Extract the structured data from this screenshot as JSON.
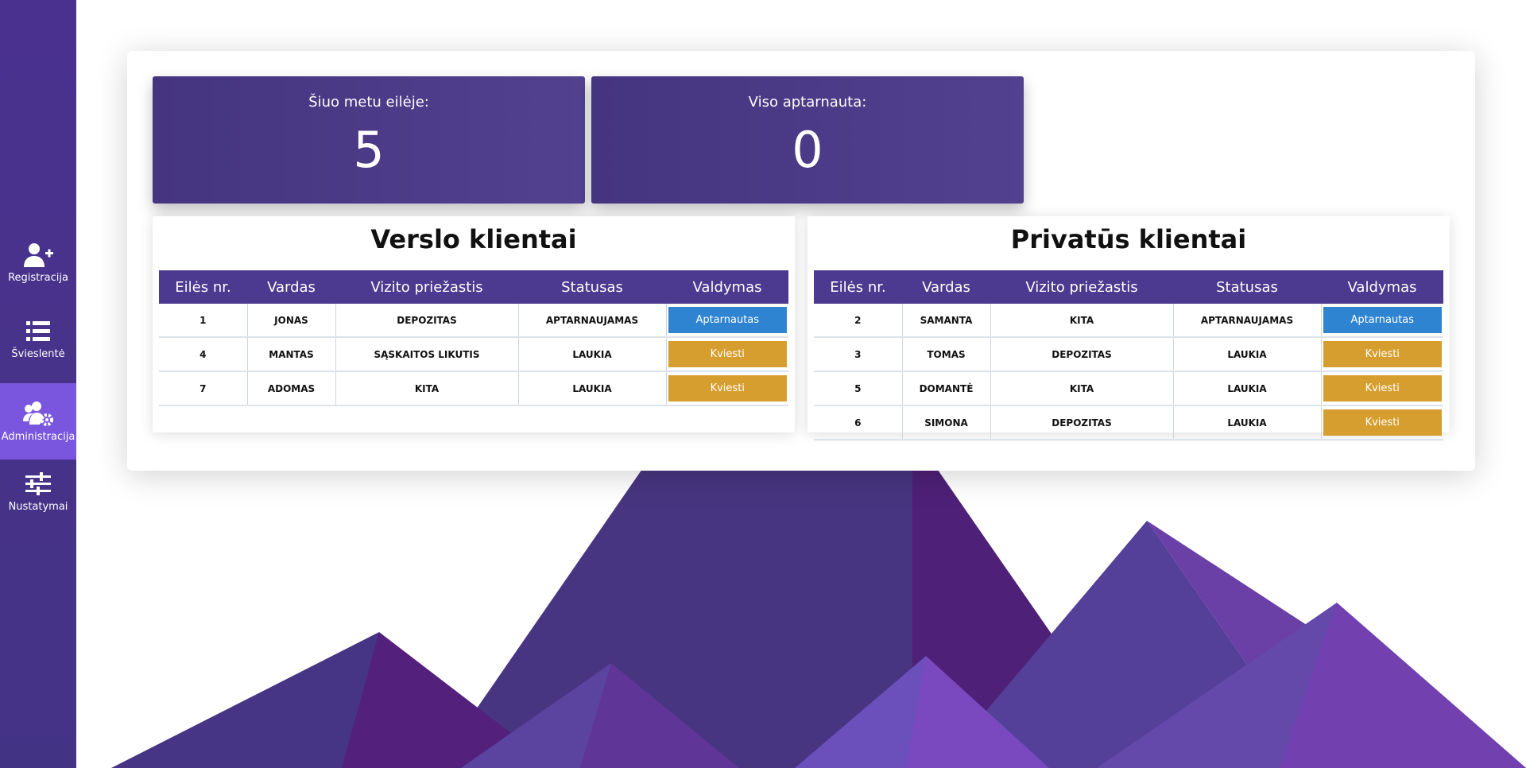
{
  "sidebar": {
    "items": [
      {
        "label": "Registracija",
        "icon": "user-plus-icon",
        "active": false
      },
      {
        "label": "Švieslentė",
        "icon": "list-icon",
        "active": false
      },
      {
        "label": "Administracija",
        "icon": "users-cog-icon",
        "active": true
      },
      {
        "label": "Nustatymai",
        "icon": "sliders-icon",
        "active": false
      }
    ]
  },
  "stats": {
    "in_queue": {
      "label": "Šiuo metu eilėje:",
      "value": "5"
    },
    "served": {
      "label": "Viso aptarnauta:",
      "value": "0"
    }
  },
  "business": {
    "title": "Verslo klientai",
    "headers": [
      "Eilės nr.",
      "Vardas",
      "Vizito priežastis",
      "Statusas",
      "Valdymas"
    ],
    "rows": [
      {
        "nr": "1",
        "name": "JONAS",
        "reason": "DEPOZITAS",
        "status": "APTARNAUJAMAS",
        "action": "Aptarnautas",
        "style": "blue"
      },
      {
        "nr": "4",
        "name": "MANTAS",
        "reason": "SĄSKAITOS LIKUTIS",
        "status": "LAUKIA",
        "action": "Kviesti",
        "style": "gold"
      },
      {
        "nr": "7",
        "name": "ADOMAS",
        "reason": "KITA",
        "status": "LAUKIA",
        "action": "Kviesti",
        "style": "gold"
      }
    ]
  },
  "private": {
    "title": "Privatūs klientai",
    "headers": [
      "Eilės nr.",
      "Vardas",
      "Vizito priežastis",
      "Statusas",
      "Valdymas"
    ],
    "rows": [
      {
        "nr": "2",
        "name": "SAMANTA",
        "reason": "KITA",
        "status": "APTARNAUJAMAS",
        "action": "Aptarnautas",
        "style": "blue"
      },
      {
        "nr": "3",
        "name": "TOMAS",
        "reason": "DEPOZITAS",
        "status": "LAUKIA",
        "action": "Kviesti",
        "style": "gold"
      },
      {
        "nr": "5",
        "name": "DOMANTĖ",
        "reason": "KITA",
        "status": "LAUKIA",
        "action": "Kviesti",
        "style": "gold"
      },
      {
        "nr": "6",
        "name": "SIMONA",
        "reason": "DEPOZITAS",
        "status": "LAUKIA",
        "action": "Kviesti",
        "style": "gold"
      }
    ]
  },
  "colors": {
    "brand": "#4b3a8f",
    "sidebar_active": "#7a55de",
    "served_button": "#2f84d2",
    "call_button": "#d69e2e"
  }
}
